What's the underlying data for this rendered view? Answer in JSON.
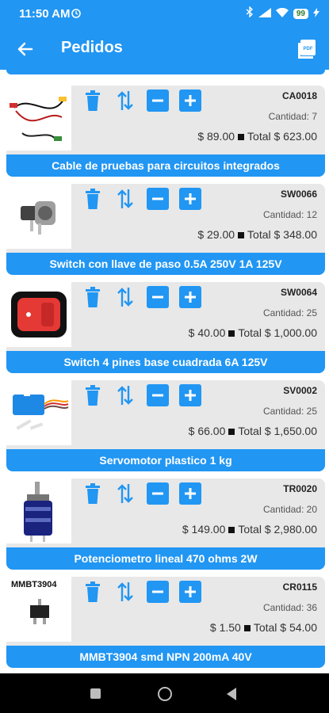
{
  "status_bar": {
    "time": "11:50 AM",
    "battery": "99"
  },
  "app_bar": {
    "title": "Pedidos"
  },
  "products": [
    {
      "code": "CA0018",
      "quantity": "Cantidad: 7",
      "price": "$ 89.00",
      "total": "Total $ 623.00",
      "name": "Cable de pruebas para circuitos integrados"
    },
    {
      "code": "SW0066",
      "quantity": "Cantidad: 12",
      "price": "$ 29.00",
      "total": "Total $ 348.00",
      "name": "Switch con llave de paso 0.5A 250V 1A 125V"
    },
    {
      "code": "SW0064",
      "quantity": "Cantidad: 25",
      "price": "$ 40.00",
      "total": "Total $ 1,000.00",
      "name": "Switch 4 pines base cuadrada 6A 125V"
    },
    {
      "code": "SV0002",
      "quantity": "Cantidad: 25",
      "price": "$ 66.00",
      "total": "Total $ 1,650.00",
      "name": "Servomotor plastico 1 kg"
    },
    {
      "code": "TR0020",
      "quantity": "Cantidad: 20",
      "price": "$ 149.00",
      "total": "Total $ 2,980.00",
      "name": "Potenciometro lineal 470 ohms 2W"
    },
    {
      "code": "CR0115",
      "quantity": "Cantidad: 36",
      "price": "$ 1.50",
      "total": "Total $ 54.00",
      "name": "MMBT3904 smd NPN 200mA 40V",
      "image_text": "MMBT3904"
    }
  ],
  "colors": {
    "primary": "#2196f3",
    "card_bg": "#e8e8e8"
  },
  "icons": [
    "back-arrow-icon",
    "pdf-icon",
    "trash-icon",
    "swap-vertical-icon",
    "minus-icon",
    "plus-icon"
  ]
}
